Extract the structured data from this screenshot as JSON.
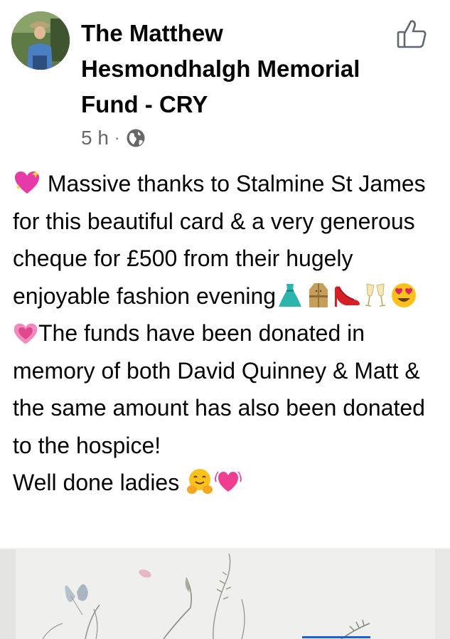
{
  "post": {
    "page_name": "The Matthew Hesmondhalgh Memorial Fund - CRY",
    "time": "5 h",
    "separator": "·",
    "privacy_icon": "globe-icon",
    "paragraphs": [
      {
        "lead_emoji": "sparkling-heart",
        "text": " Massive thanks to Stalmine St James for this beautiful card & a very generous cheque for £500 from their hugely enjoyable fashion evening",
        "trailing_emojis": [
          "dress",
          "trench-coat",
          "high-heeled-shoe",
          "clinking-glasses",
          "smiling-face-with-heart-eyes"
        ]
      },
      {
        "lead_emoji": "growing-heart",
        "text": "The funds have been donated in memory of both David Quinney & Matt & the same amount has also been donated to the hospice!"
      },
      {
        "text": "Well done ladies ",
        "trailing_emojis": [
          "hugging-face",
          "beating-heart"
        ]
      }
    ]
  },
  "icons": {
    "like": "thumbs-up-outline-icon",
    "avatar": "profile-photo"
  },
  "colors": {
    "text": "#050505",
    "meta": "#65676b",
    "accent": "#1d61d6"
  }
}
